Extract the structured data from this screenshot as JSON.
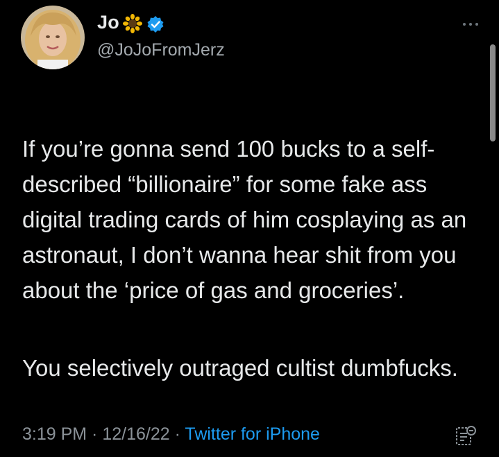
{
  "author": {
    "name": "Jo",
    "handle": "@JoJoFromJerz",
    "name_emoji_icon": "sunflower-icon",
    "verified_icon": "verified-badge-icon"
  },
  "tweet": {
    "paragraphs": [
      "If you’re gonna send 100 bucks to a self-described “billionaire” for some fake ass digital trading cards of him cosplaying as an astronaut, I don’t wanna hear shit from you about the ‘price of gas and groceries’.",
      "You selectively outraged cultist dumbfucks."
    ]
  },
  "meta": {
    "time": "3:19 PM",
    "date": "12/16/22",
    "separator": " · ",
    "source": "Twitter for iPhone"
  },
  "icons": {
    "more": "more-dots-icon",
    "analytics": "tweet-analytics-icon"
  },
  "colors": {
    "background": "#000000",
    "text": "#e7e9ea",
    "secondary_text": "#8b9298",
    "link": "#1d9bf0",
    "verified": "#1d9bf0"
  }
}
